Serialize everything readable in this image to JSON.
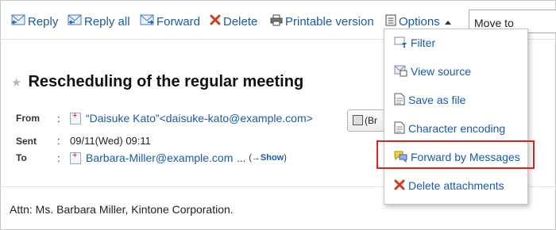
{
  "toolbar": {
    "reply": {
      "label": "Reply",
      "icon": "reply-icon"
    },
    "reply_all": {
      "label": "Reply all",
      "icon": "reply-all-icon"
    },
    "forward": {
      "label": "Forward",
      "icon": "forward-icon"
    },
    "delete": {
      "label": "Delete",
      "icon": "delete-x-icon"
    },
    "print": {
      "label": "Printable version",
      "icon": "printer-icon"
    },
    "options": {
      "label": "Options",
      "icon": "options-list-icon"
    },
    "move_to": {
      "value": "Move to"
    }
  },
  "message": {
    "subject": "Rescheduling of the regular meeting",
    "from_label": "From",
    "from_value": "“Daisuke Kato”<daisuke-kato@example.com>",
    "sent_label": "Sent",
    "sent_value": "09/11(Wed) 09:11",
    "to_label": "To",
    "to_value": "Barbara-Miller@example.com",
    "to_more": "...",
    "show_prefix": "(→",
    "show_label": "Show",
    "show_suffix": ")",
    "button_partial": "(Br",
    "body": "Attn: Ms. Barbara Miller, Kintone Corporation."
  },
  "options_menu": {
    "items": [
      {
        "label": "Filter",
        "icon": "filter-icon"
      },
      {
        "label": "View source",
        "icon": "view-source-icon"
      },
      {
        "label": "Save as file",
        "icon": "save-file-icon"
      },
      {
        "label": "Character encoding",
        "icon": "character-encoding-icon"
      },
      {
        "label": "Forward by Messages",
        "icon": "messages-icon",
        "highlighted": true
      },
      {
        "label": "Delete attachments",
        "icon": "delete-x-icon"
      }
    ]
  },
  "colors": {
    "link": "#1a5aa8",
    "highlight_border": "#e0201a",
    "delete_red": "#d03a1a"
  }
}
